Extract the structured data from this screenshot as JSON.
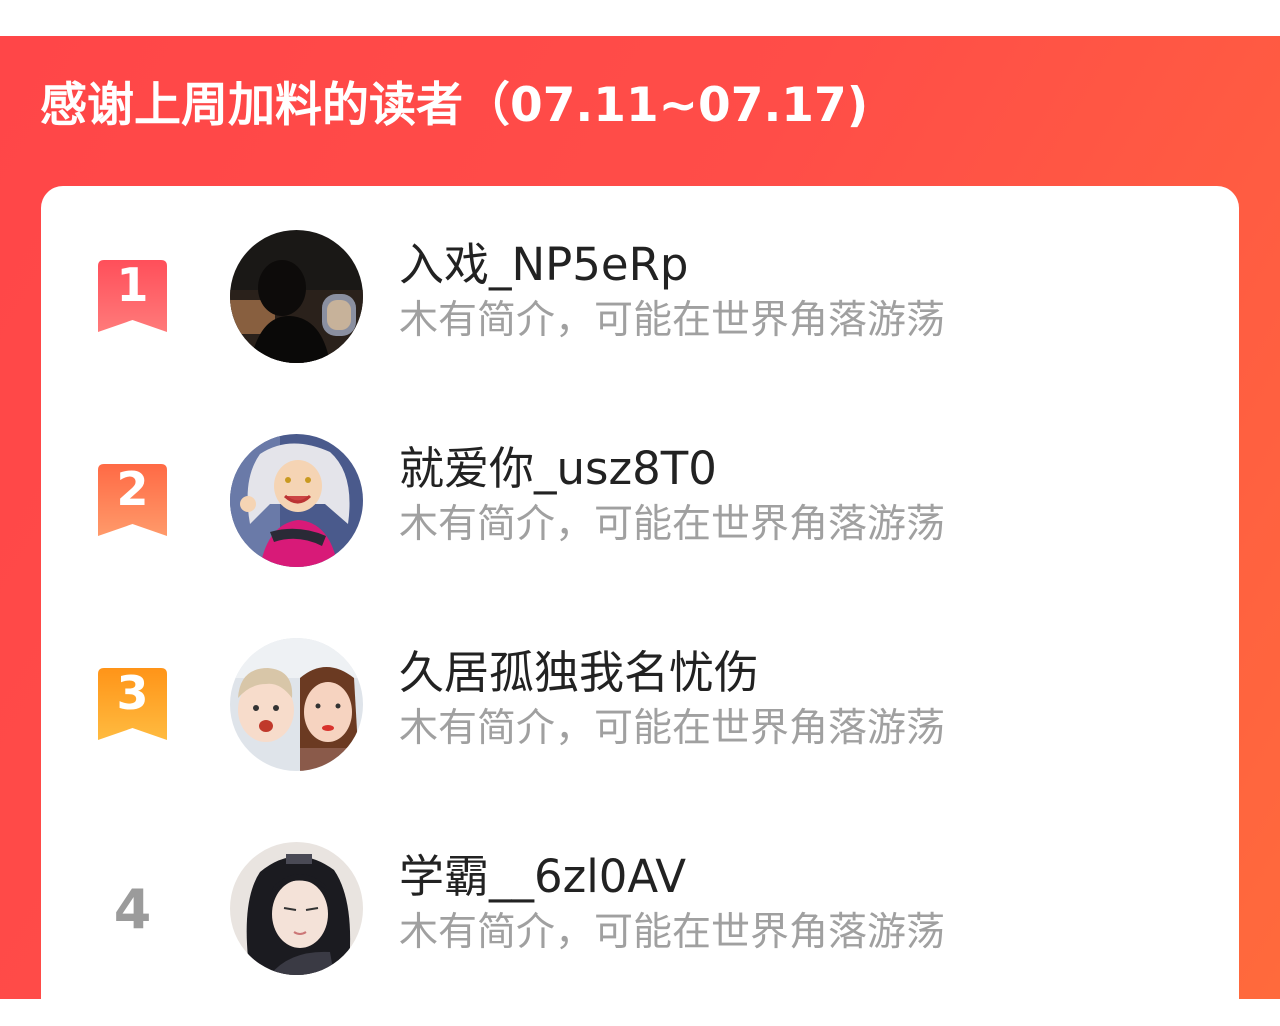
{
  "header": {
    "title": "感谢上周加料的读者（07.11~07.17)",
    "accent_color": "#ff4848"
  },
  "readers": [
    {
      "rank": "1",
      "rank_style": "badge",
      "badge_color": "#ff5f63",
      "avatar": "avatar-silhouette-airplane-window",
      "name": "入戏_NP5eRp",
      "bio": "木有简介，可能在世界角落游荡"
    },
    {
      "rank": "2",
      "rank_style": "badge",
      "badge_color": "#ff7a55",
      "avatar": "avatar-anime-silver-hair",
      "name": "就爱你_usz8T0",
      "bio": "木有简介，可能在世界角落游荡"
    },
    {
      "rank": "3",
      "rank_style": "badge",
      "badge_color": "#ffa52c",
      "avatar": "avatar-selfie-two-people",
      "name": "久居孤独我名忧伤",
      "bio": "木有简介，可能在世界角落游荡"
    },
    {
      "rank": "4",
      "rank_style": "plain",
      "avatar": "avatar-anime-black-hair",
      "name": "学霸__6zl0AV",
      "bio": "木有简介，可能在世界角落游荡"
    }
  ]
}
